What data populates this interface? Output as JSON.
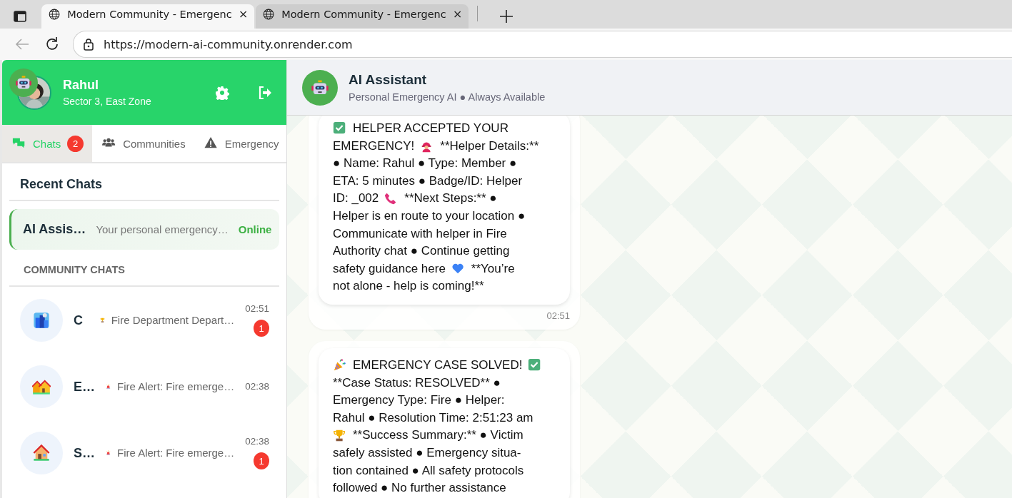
{
  "browser": {
    "tabs": [
      {
        "title": "Modern Community - Emergenc",
        "selected": true
      },
      {
        "title": "Modern Community - Emergenc",
        "selected": false
      }
    ],
    "url": "https://modern-ai-community.onrender.com"
  },
  "profile": {
    "name": "Rahul",
    "location": "Sector 3, East Zone"
  },
  "nav_tabs": [
    {
      "label": "Chats",
      "badge": "2",
      "selected": true
    },
    {
      "label": "Communities",
      "selected": false
    },
    {
      "label": "Emergency",
      "selected": false
    }
  ],
  "recent_chats": {
    "heading": "Recent Chats",
    "items": [
      {
        "name": "AI Assis…",
        "preview": "Your personal emergency…",
        "status": "Online",
        "selected": true
      }
    ]
  },
  "community_chats": {
    "heading": "COMMUNITY CHATS",
    "items": [
      {
        "name": "C",
        "preview": "Fire Department Depart…",
        "time": "02:51",
        "unread": "1"
      },
      {
        "name": "E…",
        "preview": "Fire Alert: Fire emerge…",
        "time": "02:38"
      },
      {
        "name": "S…",
        "preview": "Fire Alert: Fire emerge…",
        "time": "02:38",
        "unread": "1"
      }
    ]
  },
  "chat": {
    "title": "AI Assistant",
    "subtitle": "Personal Emergency AI ● Always Available",
    "messages": [
      {
        "lines": [
          [
            {
              "kind": "check"
            },
            {
              "kind": "text",
              "text": "HELPER ACCEPTED YOUR"
            }
          ],
          [
            {
              "kind": "text",
              "text": "EMERGENCY!"
            },
            {
              "kind": "firefighter"
            },
            {
              "kind": "text",
              "text": "**Helper Details:**"
            }
          ],
          [
            {
              "kind": "text",
              "text": "● Name: Rahul ● Type: Member ●"
            }
          ],
          [
            {
              "kind": "text",
              "text": "ETA: 5 minutes ● Badge/ID: Helper"
            }
          ],
          [
            {
              "kind": "text",
              "text": "ID: _002"
            },
            {
              "kind": "phone"
            },
            {
              "kind": "text",
              "text": "**Next Steps:** ●"
            }
          ],
          [
            {
              "kind": "text",
              "text": "Helper is en route to your location ●"
            }
          ],
          [
            {
              "kind": "text",
              "text": "Communicate with helper in Fire"
            }
          ],
          [
            {
              "kind": "text",
              "text": "Authority chat ● Continue getting"
            }
          ],
          [
            {
              "kind": "text",
              "text": "safety guidance here"
            },
            {
              "kind": "heart"
            },
            {
              "kind": "text",
              "text": "**You’re"
            }
          ],
          [
            {
              "kind": "text",
              "text": "not alone - help is coming!**"
            }
          ]
        ],
        "time": "02:51"
      },
      {
        "lines": [
          [
            {
              "kind": "party"
            },
            {
              "kind": "text",
              "text": "EMERGENCY CASE SOLVED!"
            },
            {
              "kind": "check"
            }
          ],
          [
            {
              "kind": "text",
              "text": "**Case Status: RESOLVED** ●"
            }
          ],
          [
            {
              "kind": "text",
              "text": "Emergency Type: Fire ● Helper:"
            }
          ],
          [
            {
              "kind": "text",
              "text": "Rahul ● Resolution Time: 2:51:23 am"
            }
          ],
          [
            {
              "kind": "trophy"
            },
            {
              "kind": "text",
              "text": "**Success Summary:** ● Victim"
            }
          ],
          [
            {
              "kind": "text",
              "text": "safely assisted ● Emergency situa-"
            }
          ],
          [
            {
              "kind": "text",
              "text": "tion contained ● All safety protocols"
            }
          ],
          [
            {
              "kind": "text",
              "text": "followed ● No further assistance"
            }
          ]
        ]
      }
    ]
  }
}
